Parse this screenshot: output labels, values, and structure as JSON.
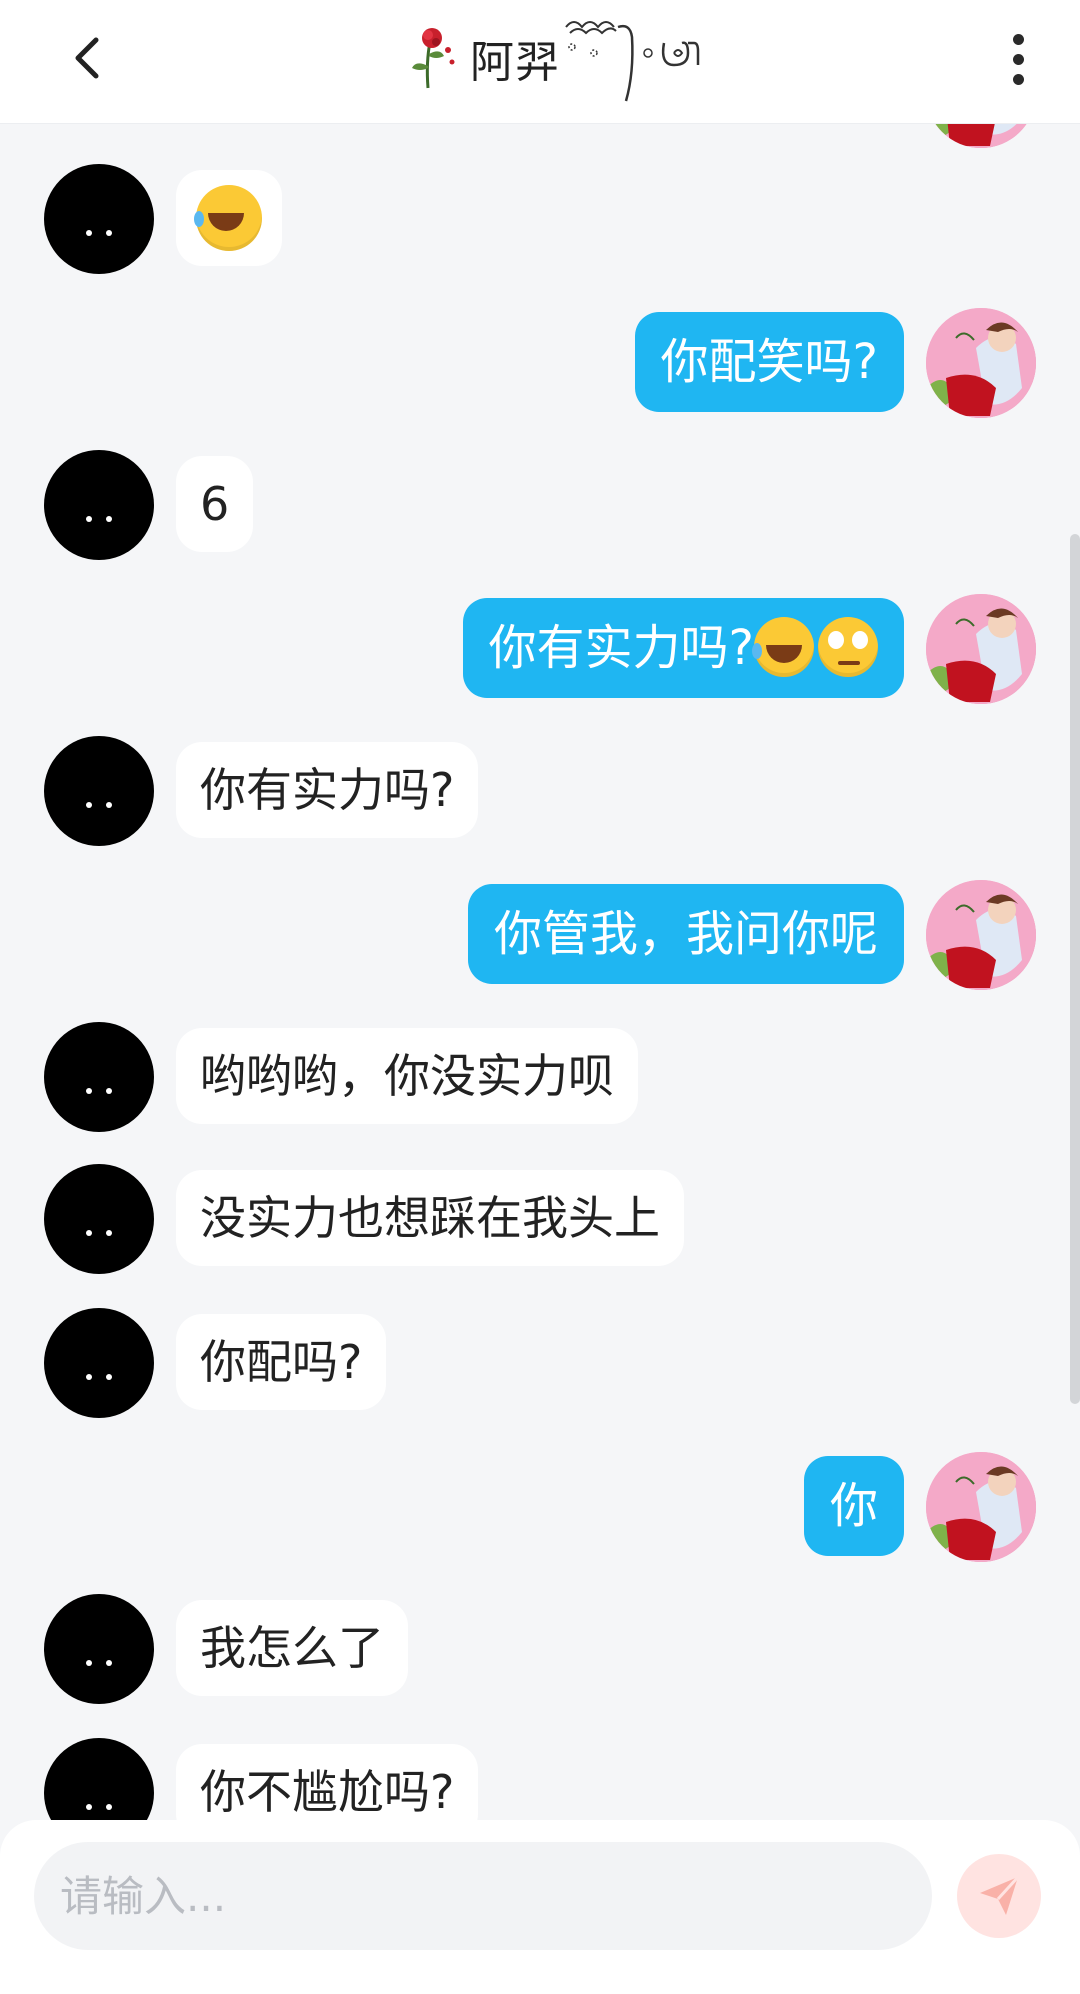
{
  "header": {
    "title": "阿羿",
    "back_icon": "chevron-left-icon",
    "menu_icon": "more-vertical-icon"
  },
  "messages": [
    {
      "from": "other",
      "type": "emoji",
      "emoji": "face-with-tears-of-joy"
    },
    {
      "from": "self",
      "text": "你配笑吗?"
    },
    {
      "from": "other",
      "text": "6"
    },
    {
      "from": "self",
      "text": "你有实力吗?",
      "emojis": [
        "face-with-tears-of-joy",
        "face-with-rolling-eyes"
      ]
    },
    {
      "from": "other",
      "text": "你有实力吗?"
    },
    {
      "from": "self",
      "text": "你管我，我问你呢"
    },
    {
      "from": "other",
      "text": "哟哟哟，你没实力呗"
    },
    {
      "from": "other",
      "text": "没实力也想踩在我头上"
    },
    {
      "from": "other",
      "text": "你配吗?"
    },
    {
      "from": "self",
      "text": "你"
    },
    {
      "from": "other",
      "text": "我怎么了"
    },
    {
      "from": "other",
      "text": "你不尴尬吗?"
    }
  ],
  "input": {
    "placeholder": "请输入...",
    "value": ""
  },
  "colors": {
    "self_bubble": "#1fb6f2",
    "other_bubble": "#ffffff",
    "background": "#f5f6f8",
    "send_button": "#ffe3e1",
    "send_icon": "#f9b1a8"
  },
  "send_icon": "paper-plane-icon"
}
